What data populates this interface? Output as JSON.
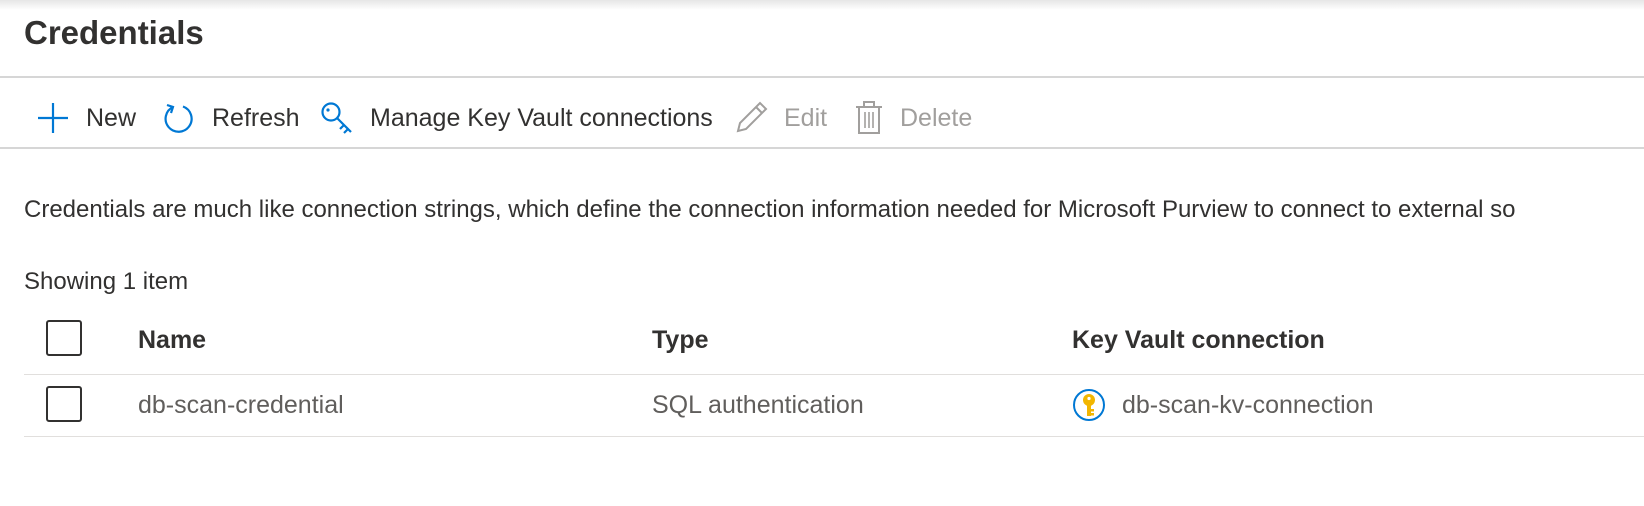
{
  "page": {
    "title": "Credentials"
  },
  "toolbar": {
    "new_label": "New",
    "refresh_label": "Refresh",
    "manage_label": "Manage Key Vault connections",
    "edit_label": "Edit",
    "delete_label": "Delete"
  },
  "description": "Credentials are much like connection strings, which define the connection information needed for Microsoft Purview to connect to external so",
  "count_text": "Showing 1 item",
  "table": {
    "headers": {
      "name": "Name",
      "type": "Type",
      "key_vault": "Key Vault connection"
    },
    "rows": [
      {
        "name": "db-scan-credential",
        "type": "SQL authentication",
        "key_vault": "db-scan-kv-connection"
      }
    ]
  },
  "colors": {
    "accent": "#0078d4",
    "disabled": "#a19f9d",
    "key_icon": "#f2b600"
  },
  "icons": {
    "new": "plus-icon",
    "refresh": "refresh-icon",
    "manage": "key-icon",
    "edit": "pencil-icon",
    "delete": "trash-icon",
    "key_vault": "key-vault-icon"
  }
}
